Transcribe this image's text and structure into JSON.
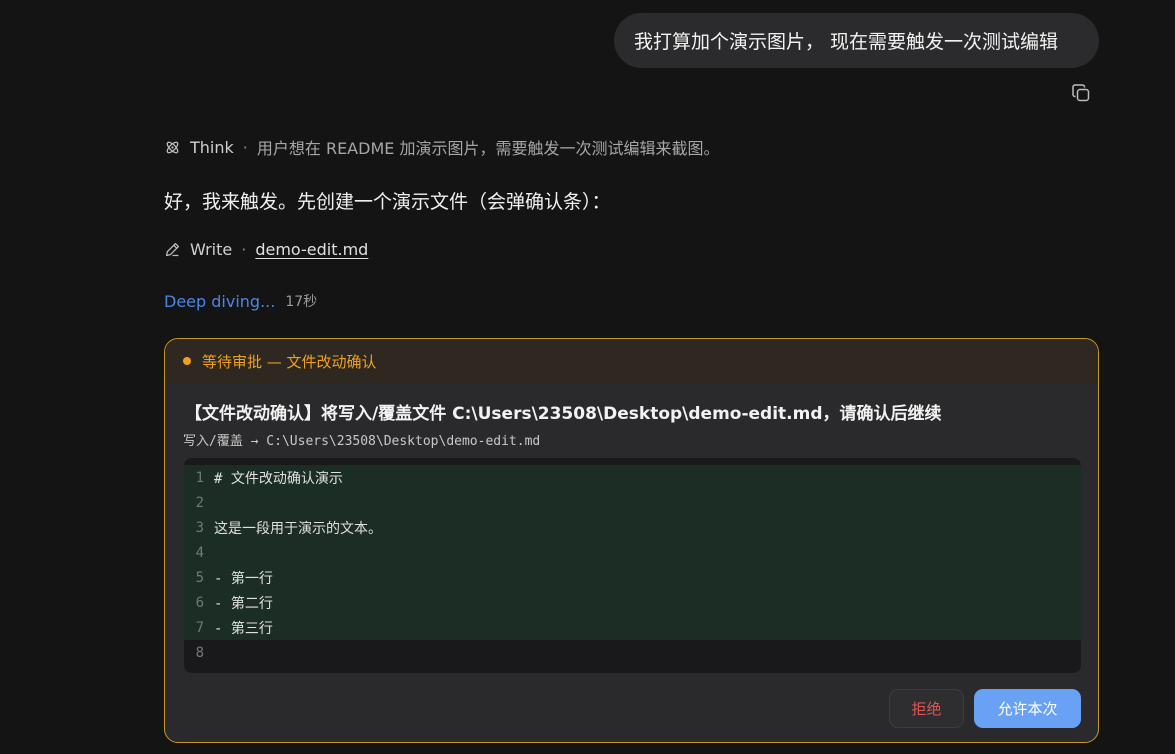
{
  "user_message": {
    "text": "我打算加个演示图片， 现在需要触发一次测试编辑"
  },
  "assistant": {
    "think": {
      "label": "Think",
      "separator": "·",
      "text": "用户想在 README 加演示图片，需要触发一次测试编辑来截图。"
    },
    "reply": "好，我来触发。先创建一个演示文件（会弹确认条）：",
    "write": {
      "label": "Write",
      "separator": "·",
      "file": "demo-edit.md"
    },
    "status": {
      "text": "Deep diving...",
      "elapsed": "17秒"
    }
  },
  "approval": {
    "header": "等待审批 — 文件改动确认",
    "title": "【文件改动确认】将写入/覆盖文件 C:\\Users\\23508\\Desktop\\demo-edit.md，请确认后继续",
    "subtitle": "写入/覆盖 → C:\\Users\\23508\\Desktop\\demo-edit.md",
    "lines": [
      {
        "num": "1",
        "text": "# 文件改动确认演示"
      },
      {
        "num": "2",
        "text": ""
      },
      {
        "num": "3",
        "text": "这是一段用于演示的文本。"
      },
      {
        "num": "4",
        "text": ""
      },
      {
        "num": "5",
        "text": "- 第一行"
      },
      {
        "num": "6",
        "text": "- 第二行"
      },
      {
        "num": "7",
        "text": "- 第三行"
      },
      {
        "num": "8",
        "text": ""
      }
    ],
    "reject_label": "拒绝",
    "allow_label": "允许本次"
  },
  "colors": {
    "accent_blue": "#4a86e8",
    "pending_orange": "#f0a020",
    "reject_red": "#e05555",
    "allow_button": "#69a2f5",
    "added_line_bg": "#1b2d25"
  },
  "icons": {
    "copy": "copy-icon",
    "think": "think-icon",
    "write": "pencil-icon"
  }
}
